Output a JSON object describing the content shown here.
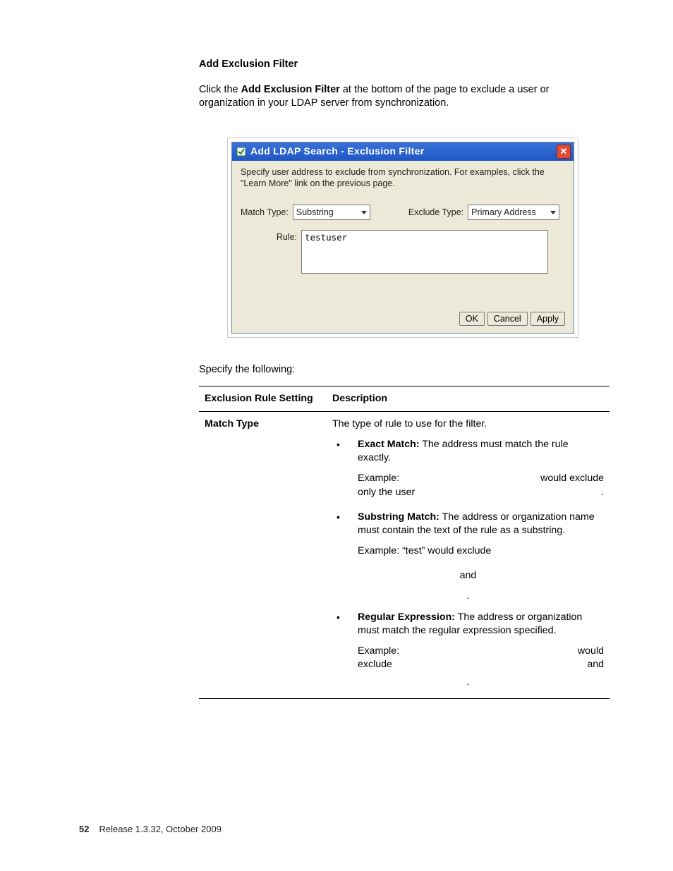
{
  "heading": "Add Exclusion Filter",
  "intro_prefix": "Click the ",
  "intro_bold": "Add Exclusion Filter",
  "intro_suffix": " at the bottom of the page to exclude a user or organization in your LDAP server from synchronization.",
  "dialog": {
    "title": "Add LDAP Search - Exclusion Filter",
    "instructions": "Specify user address to exclude from synchronization. For examples, click the \"Learn More\" link on the previous page.",
    "match_type_label": "Match Type:",
    "match_type_value": "Substring",
    "exclude_type_label": "Exclude Type:",
    "exclude_type_value": "Primary Address",
    "rule_label": "Rule:",
    "rule_value": "testuser",
    "ok": "OK",
    "cancel": "Cancel",
    "apply": "Apply"
  },
  "specify_following": "Specify the following:",
  "table": {
    "h1": "Exclusion Rule Setting",
    "h2": "Description",
    "row1_name": "Match Type",
    "row1": {
      "intro": "The type of rule to use for the filter.",
      "b1_hdr": "Exact Match:",
      "b1_txt": " The address must match the rule exactly.",
      "b1_ex_l": "Example:",
      "b1_ex_r": "would exclude",
      "b1_ex2_l": "only the user",
      "b1_ex2_r": ".",
      "b2_hdr": "Substring Match:",
      "b2_txt": " The address or organization name must contain the text of the rule as a substring.",
      "b2_ex": "Example: “test” would exclude",
      "b2_and": "and",
      "b2_dot": ".",
      "b3_hdr": "Regular Expression:",
      "b3_txt": " The address or organization must match the regular expression specified.",
      "b3_ex_l": "Example:",
      "b3_ex_r": "would",
      "b3_ex2_l": "exclude",
      "b3_ex2_r": "and",
      "b3_dot": "."
    }
  },
  "footer": {
    "page": "52",
    "release": "Release 1.3.32, October 2009"
  }
}
